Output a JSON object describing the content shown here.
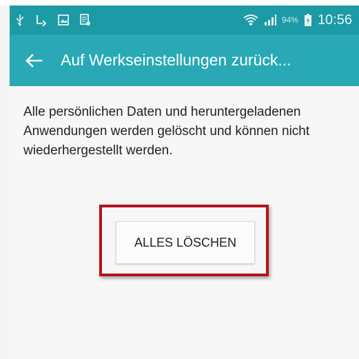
{
  "status_bar": {
    "icons_left": [
      "usb-icon",
      "screenshot-icon",
      "gallery-icon",
      "document-icon"
    ],
    "icons_right": [
      "wifi-icon",
      "signal-icon"
    ],
    "battery_percent": "94%",
    "time": "10:56"
  },
  "app_bar": {
    "back_icon": "back-arrow-icon",
    "title": "Auf Werkseinstellungen zurück..."
  },
  "main": {
    "description": "Alle persönlichen Daten und heruntergeladenen Anwendungen werden gelöscht und können nicht wiederhergestellt werden.",
    "button_label": "ALLES LÖSCHEN"
  },
  "colors": {
    "status_bar": "#1c9aa6",
    "app_bar": "#28a9b5",
    "highlight": "#b5121b"
  }
}
